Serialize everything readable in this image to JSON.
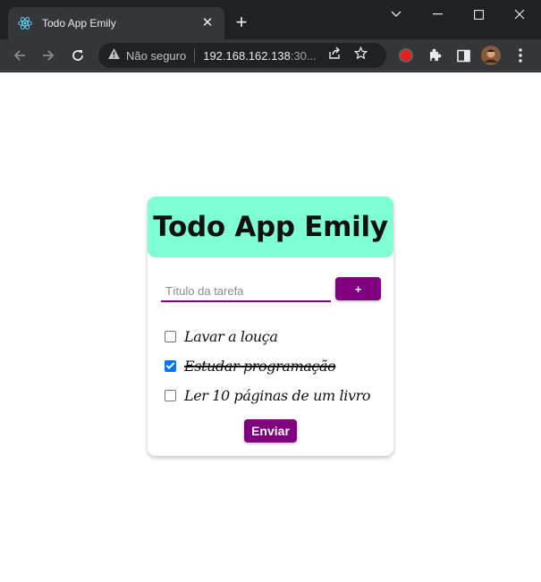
{
  "browser": {
    "tab_title": "Todo App Emily",
    "tab_icon": "react-icon",
    "security_label": "Não seguro",
    "url_host": "192.168.162.138",
    "url_port": ":30..."
  },
  "app": {
    "title": "Todo App Emily",
    "input_placeholder": "Título da tarefa",
    "add_label": "+",
    "submit_label": "Enviar",
    "accent_color": "#800080",
    "header_color": "#7fffd4",
    "todos": [
      {
        "label": "Lavar a louça",
        "done": false
      },
      {
        "label": "Estudar programação",
        "done": true
      },
      {
        "label": "Ler 10 páginas de um livro",
        "done": false
      }
    ]
  }
}
